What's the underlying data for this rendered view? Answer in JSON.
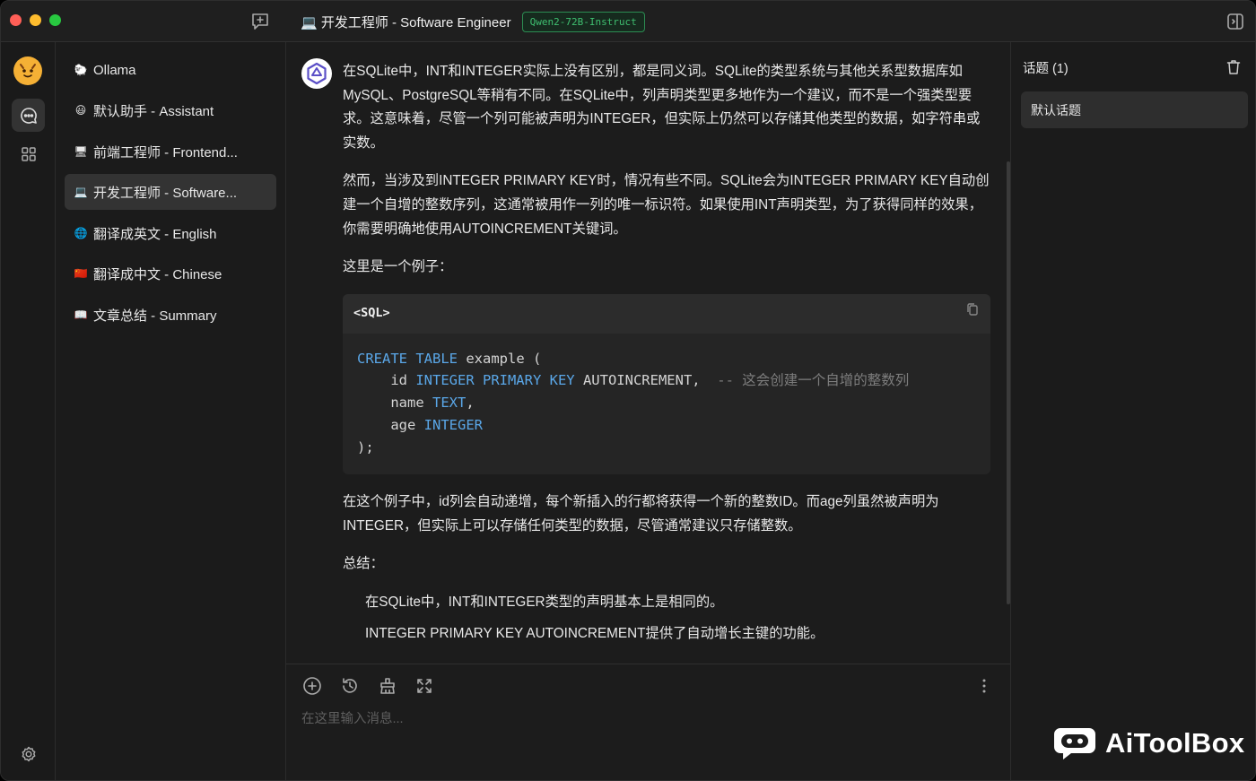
{
  "titlebar": {
    "title": "💻 开发工程师 - Software Engineer",
    "model_badge": "Qwen2-72B-Instruct"
  },
  "agents": [
    {
      "emoji": "🐑",
      "label": "Ollama"
    },
    {
      "emoji": "😃",
      "label": "默认助手 - Assistant"
    },
    {
      "emoji": "🖥",
      "label": "前端工程师 - Frontend..."
    },
    {
      "emoji": "💻",
      "label": "开发工程师 - Software..."
    },
    {
      "emoji": "🌐",
      "label": "翻译成英文 - English"
    },
    {
      "emoji": "🇨🇳",
      "label": "翻译成中文 - Chinese"
    },
    {
      "emoji": "📖",
      "label": "文章总结 - Summary"
    }
  ],
  "message": {
    "p1": "在SQLite中，INT和INTEGER实际上没有区别，都是同义词。SQLite的类型系统与其他关系型数据库如MySQL、PostgreSQL等稍有不同。在SQLite中，列声明类型更多地作为一个建议，而不是一个强类型要求。这意味着，尽管一个列可能被声明为INTEGER，但实际上仍然可以存储其他类型的数据，如字符串或实数。",
    "p2": "然而，当涉及到INTEGER PRIMARY KEY时，情况有些不同。SQLite会为INTEGER PRIMARY KEY自动创建一个自增的整数序列，这通常被用作一列的唯一标识符。如果使用INT声明类型，为了获得同样的效果，你需要明确地使用AUTOINCREMENT关键词。",
    "p3": "这里是一个例子：",
    "code_lang": "<SQL>",
    "code": {
      "l1_kw1": "CREATE",
      "l1_kw2": "TABLE",
      "l1_rest": " example (",
      "l2_pre": "    id ",
      "l2_kw": "INTEGER PRIMARY KEY",
      "l2_rest": " AUTOINCREMENT,  ",
      "l2_comment": "-- 这会创建一个自增的整数列",
      "l3_pre": "    name ",
      "l3_kw": "TEXT",
      "l3_rest": ",",
      "l4_pre": "    age ",
      "l4_kw": "INTEGER",
      "l5": ");"
    },
    "p4": "在这个例子中，id列会自动递增，每个新插入的行都将获得一个新的整数ID。而age列虽然被声明为INTEGER，但实际上可以存储任何类型的数据，尽管通常建议只存储整数。",
    "p5": "总结：",
    "summary": [
      "在SQLite中，INT和INTEGER类型的声明基本上是相同的。",
      "INTEGER PRIMARY KEY AUTOINCREMENT提供了自动增长主键的功能。"
    ]
  },
  "input": {
    "placeholder": "在这里输入消息..."
  },
  "topics": {
    "title": "话题 (1)",
    "items": [
      "默认话题"
    ]
  },
  "watermark": {
    "text": "AiToolBox"
  },
  "colors": {
    "accent_green": "#3fbf70",
    "keyword_blue": "#5aa7e8"
  }
}
